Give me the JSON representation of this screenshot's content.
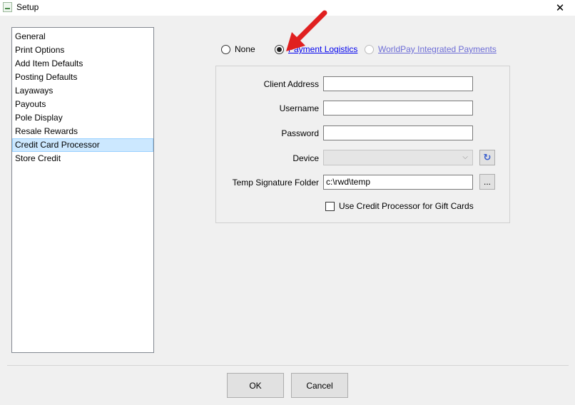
{
  "window": {
    "title": "Setup",
    "close_glyph": "✕"
  },
  "nav": {
    "items": [
      {
        "label": "General"
      },
      {
        "label": "Print Options"
      },
      {
        "label": "Add Item Defaults"
      },
      {
        "label": "Posting Defaults"
      },
      {
        "label": "Layaways"
      },
      {
        "label": "Payouts"
      },
      {
        "label": "Pole Display"
      },
      {
        "label": "Resale Rewards"
      },
      {
        "label": "Credit Card Processor"
      },
      {
        "label": "Store Credit"
      }
    ],
    "selected": "Credit Card Processor"
  },
  "processor": {
    "options": [
      {
        "label": "None",
        "selected": false
      },
      {
        "label": "Payment Logistics",
        "selected": true
      },
      {
        "label": "WorldPay Integrated Payments",
        "selected": false,
        "disabled": true
      }
    ]
  },
  "form": {
    "client_address_label": "Client Address",
    "client_address_value": "",
    "username_label": "Username",
    "username_value": "",
    "password_label": "Password",
    "password_value": "",
    "device_label": "Device",
    "device_value": "",
    "device_arrow": "⌵",
    "refresh_icon": "refresh-icon",
    "refresh_glyph": "↻",
    "temp_folder_label": "Temp Signature Folder",
    "temp_folder_value": "c:\\rwd\\temp",
    "browse_label": "...",
    "gift_cards_label": "Use Credit Processor for Gift Cards",
    "gift_cards_checked": false
  },
  "buttons": {
    "ok_label": "OK",
    "cancel_label": "Cancel"
  },
  "colors": {
    "selection_bg": "#cce8ff",
    "link": "#0000ee",
    "annotation_arrow": "#e02020"
  }
}
